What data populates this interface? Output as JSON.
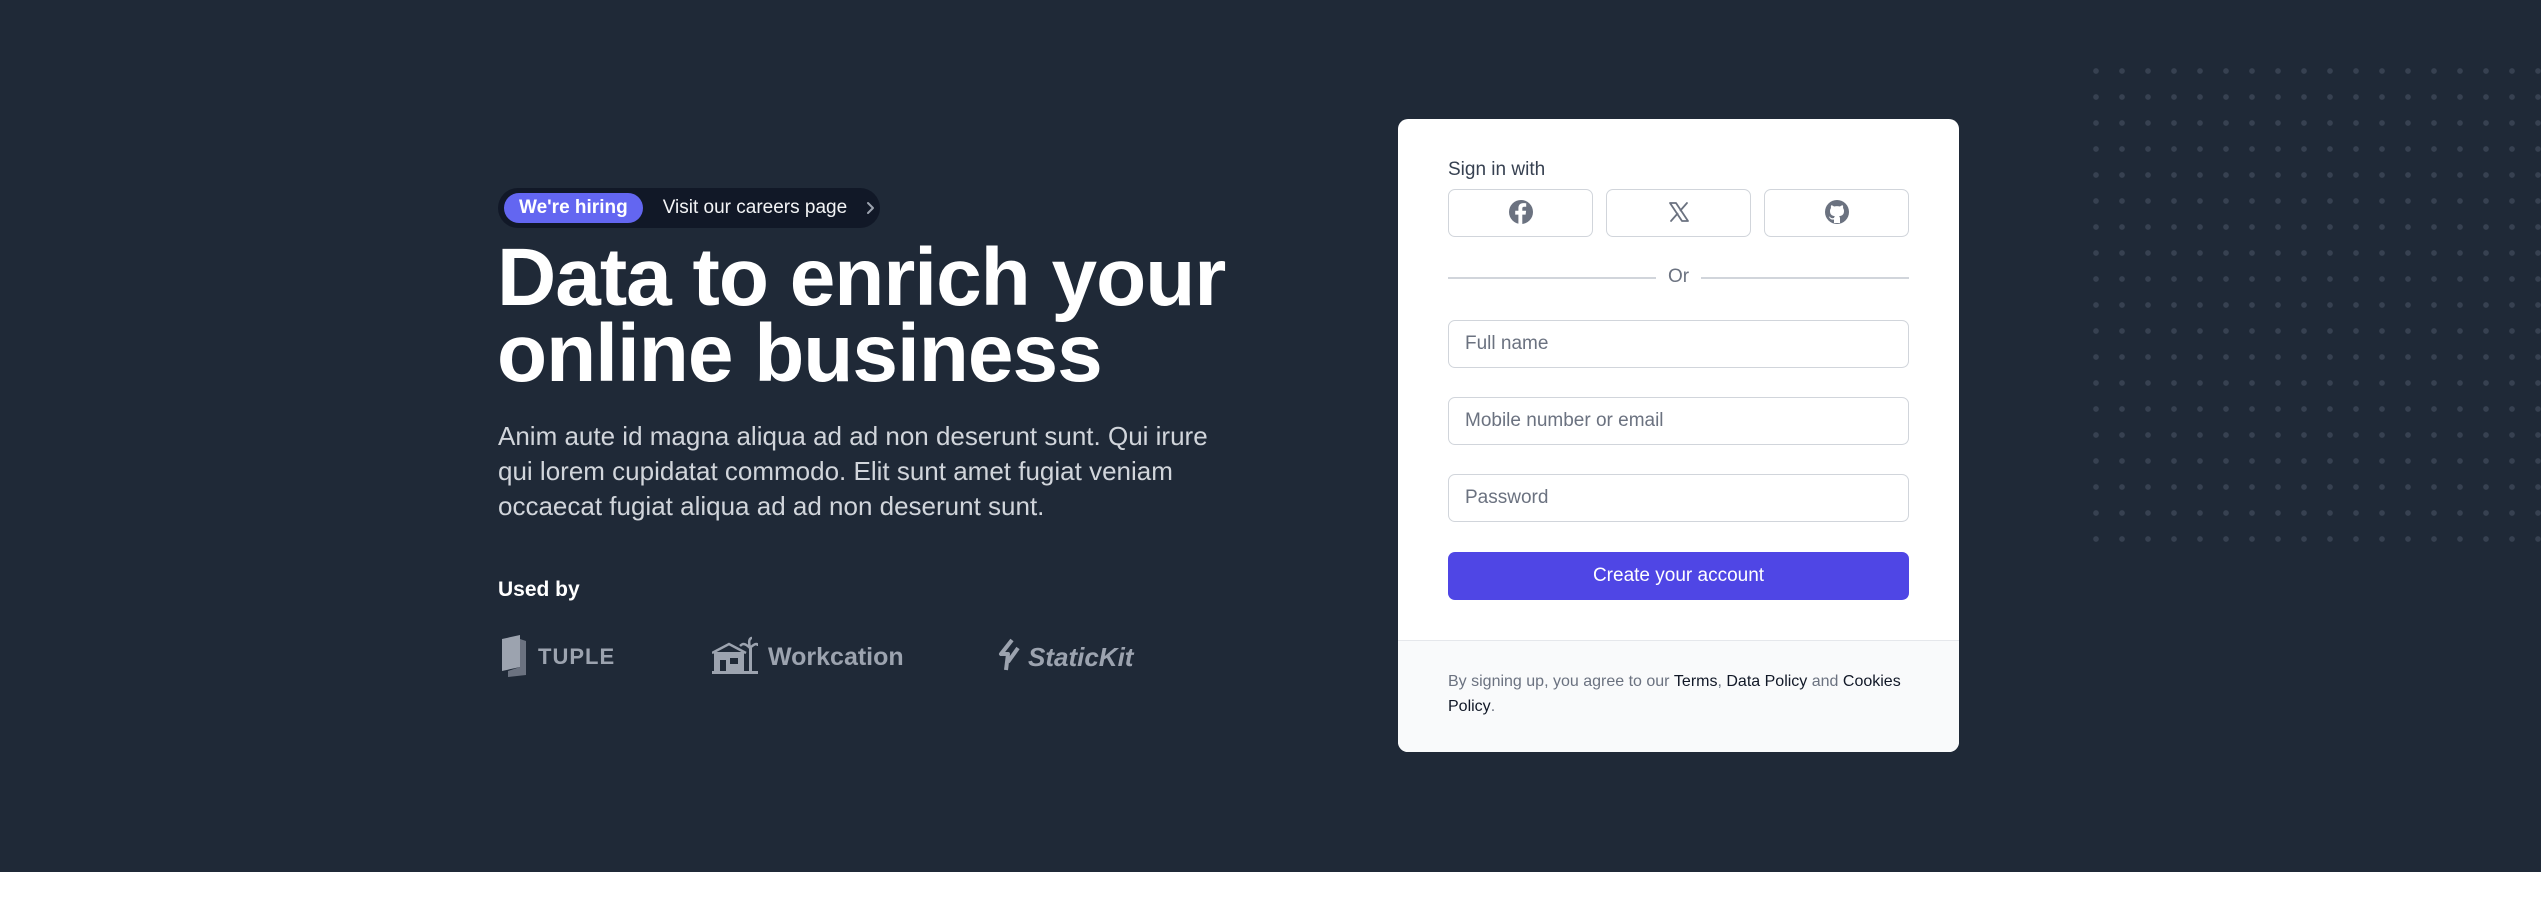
{
  "banner": {
    "badge": "We're hiring",
    "link_text": "Visit our careers page",
    "chevron_icon": "chevron-right-icon"
  },
  "hero": {
    "headline_line1": "Data to enrich your",
    "headline_line2": "online business",
    "lead": "Anim aute id magna aliqua ad ad non deserunt sunt. Qui irure qui lorem cupidatat commodo. Elit sunt amet fugiat veniam occaecat fugiat aliqua ad ad non deserunt sunt."
  },
  "used_by": {
    "label": "Used by",
    "logos": [
      {
        "name": "TUPLE",
        "icon": "tuple-logo-icon"
      },
      {
        "name": "Workcation",
        "icon": "workcation-logo-icon"
      },
      {
        "name": "StaticKit",
        "icon": "statickit-logo-icon"
      }
    ]
  },
  "form": {
    "signin_label": "Sign in with",
    "social": [
      {
        "icon": "facebook-icon"
      },
      {
        "icon": "x-icon"
      },
      {
        "icon": "github-icon"
      }
    ],
    "divider_text": "Or",
    "full_name_placeholder": "Full name",
    "contact_placeholder": "Mobile number or email",
    "password_placeholder": "Password",
    "submit_label": "Create your account"
  },
  "footer": {
    "prefix": "By signing up, you agree to our ",
    "terms_link": "Terms",
    "comma": ", ",
    "data_policy_link": "Data Policy",
    "and_text": " and ",
    "cookies_link": "Cookies Policy",
    "period": "."
  },
  "colors": {
    "background": "#1f2937",
    "accent": "#4f46e5",
    "badge": "#6366f1"
  }
}
